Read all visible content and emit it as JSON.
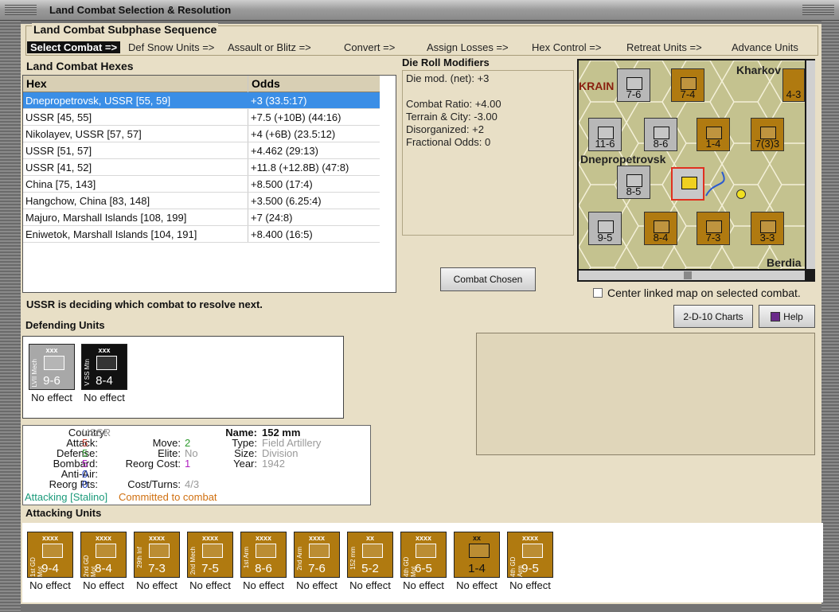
{
  "window_title": "Land Combat Selection & Resolution",
  "phase": {
    "title": "Land Combat Subphase Sequence",
    "steps": [
      "Select Combat =>",
      "Def Snow Units =>",
      "Assault or Blitz =>",
      "Convert =>",
      "Assign Losses =>",
      "Hex Control =>",
      "Retreat Units =>",
      "Advance Units"
    ]
  },
  "hexes": {
    "title": "Land Combat Hexes",
    "col_hex": "Hex",
    "col_odds": "Odds",
    "rows": [
      {
        "hex": "Dnepropetrovsk, USSR [55, 59]",
        "odds": "+3 (33.5:17)"
      },
      {
        "hex": "USSR [45, 55]",
        "odds": "+7.5 (+10B) (44:16)"
      },
      {
        "hex": "Nikolayev, USSR [57, 57]",
        "odds": "+4 (+6B) (23.5:12)"
      },
      {
        "hex": "USSR [51, 57]",
        "odds": "+4.462 (29:13)"
      },
      {
        "hex": "USSR [41, 52]",
        "odds": "+11.8 (+12.8B) (47:8)"
      },
      {
        "hex": "China [75, 143]",
        "odds": "+8.500 (17:4)"
      },
      {
        "hex": "Hangchow, China [83, 148]",
        "odds": "+3.500 (6.25:4)"
      },
      {
        "hex": "Majuro, Marshall Islands [108, 199]",
        "odds": "+7 (24:8)"
      },
      {
        "hex": "Eniwetok, Marshall Islands [104, 191]",
        "odds": "+8.400 (16:5)"
      }
    ]
  },
  "drm": {
    "title": "Die Roll Modifiers",
    "lines": [
      "Die mod. (net): +3",
      "",
      "Combat Ratio: +4.00",
      "Terrain & City: -3.00",
      "Disorganized: +2",
      "Fractional Odds: 0"
    ]
  },
  "map": {
    "cities": [
      "KRAIN",
      "Kharkov",
      "Dnepropetrovsk",
      "Berdia"
    ],
    "counters": [
      "7-6",
      "7-4",
      "4-3",
      "11-6",
      "8-6",
      "1-4",
      "7(3)3",
      "8-5",
      "9-5",
      "8-4",
      "7-3",
      "3-3"
    ]
  },
  "buttons": {
    "combat_chosen": "Combat Chosen",
    "charts": "2-D-10 Charts",
    "help": "Help"
  },
  "center_linked": "Center linked map on selected combat.",
  "status": "USSR is deciding which combat to resolve next.",
  "defending": {
    "title": "Defending Units",
    "units": [
      {
        "name": "LVII Mech",
        "size": "xxx",
        "strength": "9-6",
        "effect": "No effect"
      },
      {
        "name": "V SS Mtn",
        "size": "xxx",
        "strength": "8-4",
        "effect": "No effect"
      }
    ]
  },
  "info": {
    "country_label": "Country:",
    "country": "USSR",
    "attack_label": "Attack:",
    "attack": "5",
    "defense_label": "Defense:",
    "defense": "5",
    "bombard_label": "Bombard:",
    "bombard": "5",
    "antiair_label": "Anti-Air:",
    "antiair": "0",
    "reorg_pts_label": "Reorg Pts:",
    "reorg_pts": "0",
    "move_label": "Move:",
    "move": "2",
    "elite_label": "Elite:",
    "elite": "No",
    "reorg_cost_label": "Reorg Cost:",
    "reorg_cost": "1",
    "cost_turns_label": "Cost/Turns:",
    "cost_turns": "4/3",
    "name_label": "Name:",
    "name": "152 mm",
    "type_label": "Type:",
    "type": "Field Artillery",
    "size_label": "Size:",
    "size": "Division",
    "year_label": "Year:",
    "year": "1942",
    "attacking": "Attacking [Stalino]",
    "committed": "Committed to combat"
  },
  "attacking": {
    "title": "Attacking Units",
    "units": [
      {
        "name": "1st GD Mot",
        "size": "xxxx",
        "strength": "9-4",
        "effect": "No effect"
      },
      {
        "name": "2nd GD Mot",
        "size": "xxxx",
        "strength": "8-4",
        "effect": "No effect"
      },
      {
        "name": "29th Inf",
        "size": "xxxx",
        "strength": "7-3",
        "effect": "No effect"
      },
      {
        "name": "2nd Mech",
        "size": "xxxx",
        "strength": "7-5",
        "effect": "No effect"
      },
      {
        "name": "1st Arm",
        "size": "xxxx",
        "strength": "8-6",
        "effect": "No effect"
      },
      {
        "name": "2nd Arm",
        "size": "xxxx",
        "strength": "7-6",
        "effect": "No effect"
      },
      {
        "name": "152 mm",
        "size": "xx",
        "strength": "5-2",
        "effect": "No effect"
      },
      {
        "name": "4th GD Mot",
        "size": "xxxx",
        "strength": "6-5",
        "effect": "No effect"
      },
      {
        "name": "",
        "size": "xx",
        "strength": "1-4",
        "effect": "No effect"
      },
      {
        "name": "4th GD Arm",
        "size": "xxxx",
        "strength": "9-5",
        "effect": "No effect"
      }
    ]
  },
  "colors": {
    "attack": "#c0392b",
    "defense": "#2e9a2e",
    "bombard": "#b020c0",
    "antiair": "#2040c0",
    "soviet": "#b07a10",
    "selection": "#3a8ee6"
  }
}
